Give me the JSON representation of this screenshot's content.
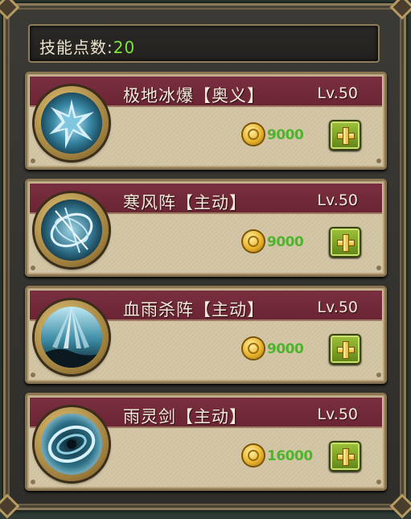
{
  "skill_points": {
    "label": "技能点数:",
    "value": "20"
  },
  "skills": [
    {
      "name": "极地冰爆【奥义】",
      "level": "Lv.50",
      "cost": "9000",
      "icon": "ice-burst-icon"
    },
    {
      "name": "寒风阵【主动】",
      "level": "Lv.50",
      "cost": "9000",
      "icon": "cold-wind-formation-icon"
    },
    {
      "name": "血雨杀阵【主动】",
      "level": "Lv.50",
      "cost": "9000",
      "icon": "blood-rain-formation-icon"
    },
    {
      "name": "雨灵剑【主动】",
      "level": "Lv.50",
      "cost": "16000",
      "icon": "rain-spirit-sword-icon"
    }
  ],
  "colors": {
    "accent_green": "#7fe33a",
    "header_red": "#7a2f3f",
    "cost_green": "#4cb52c"
  }
}
